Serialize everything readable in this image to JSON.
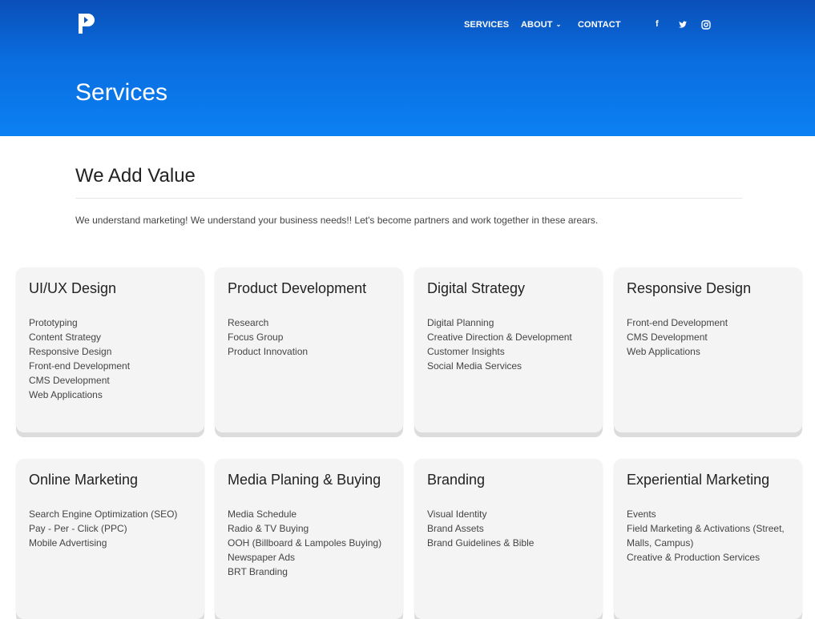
{
  "header": {
    "nav": {
      "services": "SERVICES",
      "about": "ABOUT",
      "contact": "CONTACT"
    },
    "social": {
      "facebook_icon": "f",
      "twitter_icon": "t",
      "instagram_icon": "ig"
    },
    "hero_title": "Services"
  },
  "intro": {
    "title": "We Add Value",
    "text": "We understand marketing! We understand your business needs!! Let's become partners and work together in these arears."
  },
  "services": [
    {
      "title": "UI/UX Design",
      "items": [
        "Prototyping",
        "Content Strategy",
        "Responsive Design",
        "Front-end Development",
        "CMS Development",
        "Web Applications"
      ]
    },
    {
      "title": "Product Development",
      "items": [
        "Research",
        "Focus Group",
        "Product Innovation"
      ]
    },
    {
      "title": "Digital Strategy",
      "items": [
        "Digital Planning",
        "Creative Direction & Development",
        "Customer Insights",
        "Social Media Services"
      ]
    },
    {
      "title": "Responsive Design",
      "items": [
        "Front-end Development",
        "CMS Development",
        "Web Applications"
      ]
    },
    {
      "title": "Online Marketing",
      "items": [
        "Search Engine Optimization (SEO)",
        "Pay - Per - Click (PPC)",
        "Mobile Advertising"
      ]
    },
    {
      "title": "Media Planing & Buying",
      "items": [
        "Media Schedule",
        "Radio & TV Buying",
        "OOH (Billboard & Lampoles Buying)",
        "Newspaper Ads",
        "BRT Branding"
      ]
    },
    {
      "title": "Branding",
      "items": [
        "Visual Identity",
        "Brand Assets",
        "Brand Guidelines & Bible"
      ]
    },
    {
      "title": "Experiential Marketing",
      "items": [
        "Events",
        "Field Marketing & Activations (Street, Malls, Campus)",
        "Creative & Production Services"
      ]
    }
  ]
}
